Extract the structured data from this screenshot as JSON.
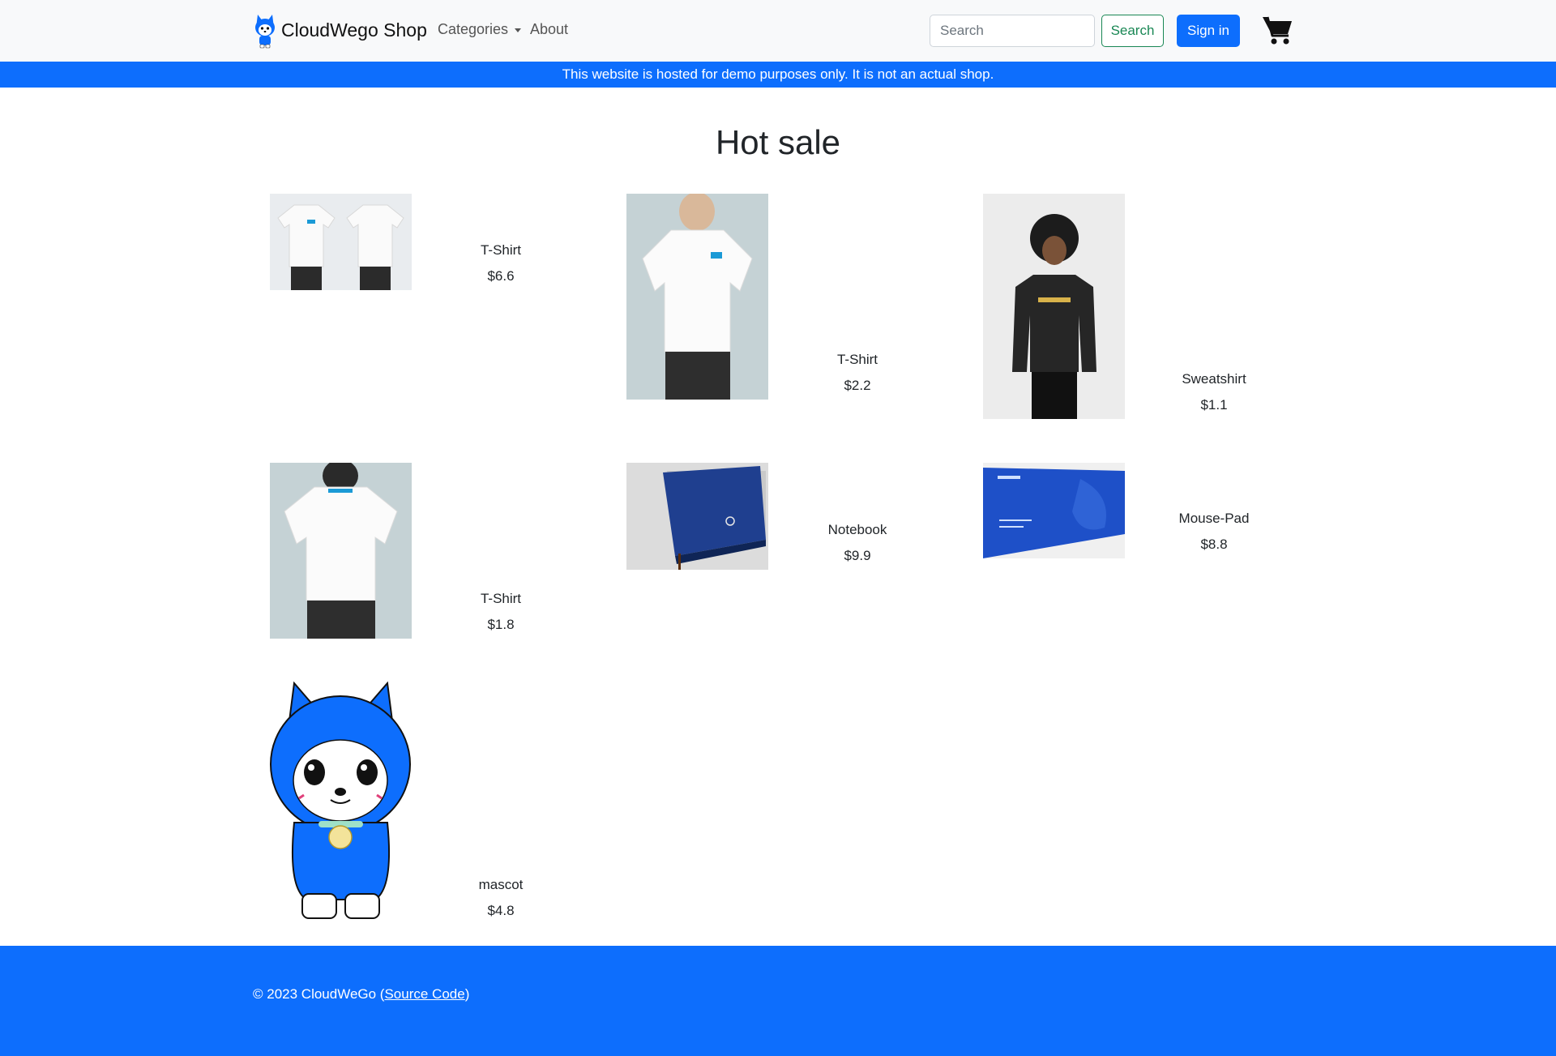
{
  "brand": {
    "name": "CloudWego Shop"
  },
  "nav": {
    "categories_label": "Categories",
    "about_label": "About"
  },
  "search": {
    "placeholder": "Search",
    "button_label": "Search"
  },
  "auth": {
    "signin_label": "Sign in"
  },
  "banner": {
    "text": "This website is hosted for demo purposes only. It is not an actual shop."
  },
  "main": {
    "title": "Hot sale",
    "products": [
      {
        "name": "T-Shirt",
        "price": "$6.6",
        "image": "tshirt-front-back-photo"
      },
      {
        "name": "T-Shirt",
        "price": "$2.2",
        "image": "tshirt-front-photo"
      },
      {
        "name": "Sweatshirt",
        "price": "$1.1",
        "image": "sweatshirt-photo"
      },
      {
        "name": "T-Shirt",
        "price": "$1.8",
        "image": "tshirt-back-photo"
      },
      {
        "name": "Notebook",
        "price": "$9.9",
        "image": "notebook-photo"
      },
      {
        "name": "Mouse-Pad",
        "price": "$8.8",
        "image": "mouse-pad-photo"
      },
      {
        "name": "mascot",
        "price": "$4.8",
        "image": "mascot-illustration"
      }
    ]
  },
  "footer": {
    "copyright": "© 2023 CloudWeGo (",
    "link_label": "Source Code",
    "closing": ")"
  },
  "colors": {
    "primary": "#0d6efd",
    "success": "#198754",
    "navbar_bg": "#f8f9fa",
    "text": "#212529"
  }
}
